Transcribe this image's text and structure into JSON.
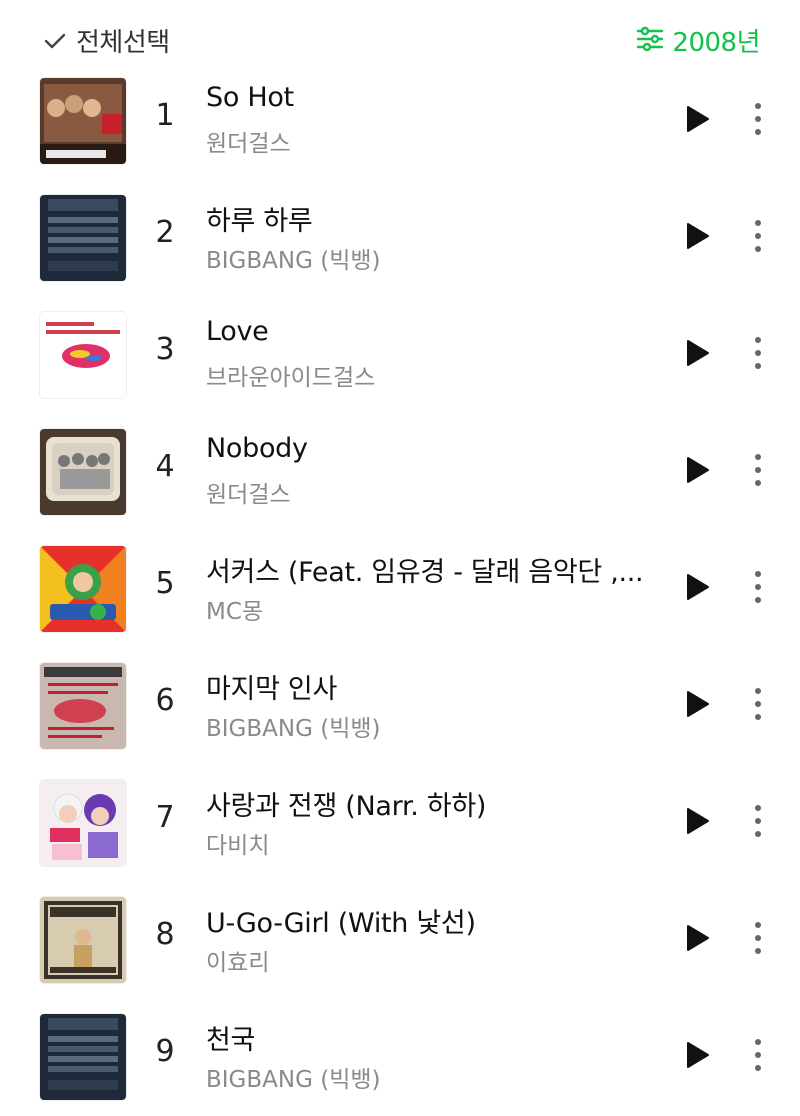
{
  "header": {
    "select_all_label": "전체선택",
    "year_label": "2008년",
    "accent_color": "#14c14b"
  },
  "tracks": [
    {
      "rank": "1",
      "title": "So Hot",
      "artist": "원더걸스",
      "cover_icon": "album-cover-so-hot"
    },
    {
      "rank": "2",
      "title": "하루 하루",
      "artist": "BIGBANG (빅뱅)",
      "cover_icon": "album-cover-stand-up"
    },
    {
      "rank": "3",
      "title": "Love",
      "artist": "브라운아이드걸스",
      "cover_icon": "album-cover-with-love"
    },
    {
      "rank": "4",
      "title": "Nobody",
      "artist": "원더걸스",
      "cover_icon": "album-cover-nobody"
    },
    {
      "rank": "5",
      "title": "서커스 (Feat. 임유경 - 달래 음악단 ,...",
      "artist": "MC몽",
      "cover_icon": "album-cover-mc-mong"
    },
    {
      "rank": "6",
      "title": "마지막 인사",
      "artist": "BIGBANG (빅뱅)",
      "cover_icon": "album-cover-bigbang-mini2"
    },
    {
      "rank": "7",
      "title": "사랑과 전쟁 (Narr. 하하)",
      "artist": "다비치",
      "cover_icon": "album-cover-davichi"
    },
    {
      "rank": "8",
      "title": "U-Go-Girl (With 낯선)",
      "artist": "이효리",
      "cover_icon": "album-cover-it-s-hot"
    },
    {
      "rank": "9",
      "title": "천국",
      "artist": "BIGBANG (빅뱅)",
      "cover_icon": "album-cover-stand-up"
    }
  ]
}
